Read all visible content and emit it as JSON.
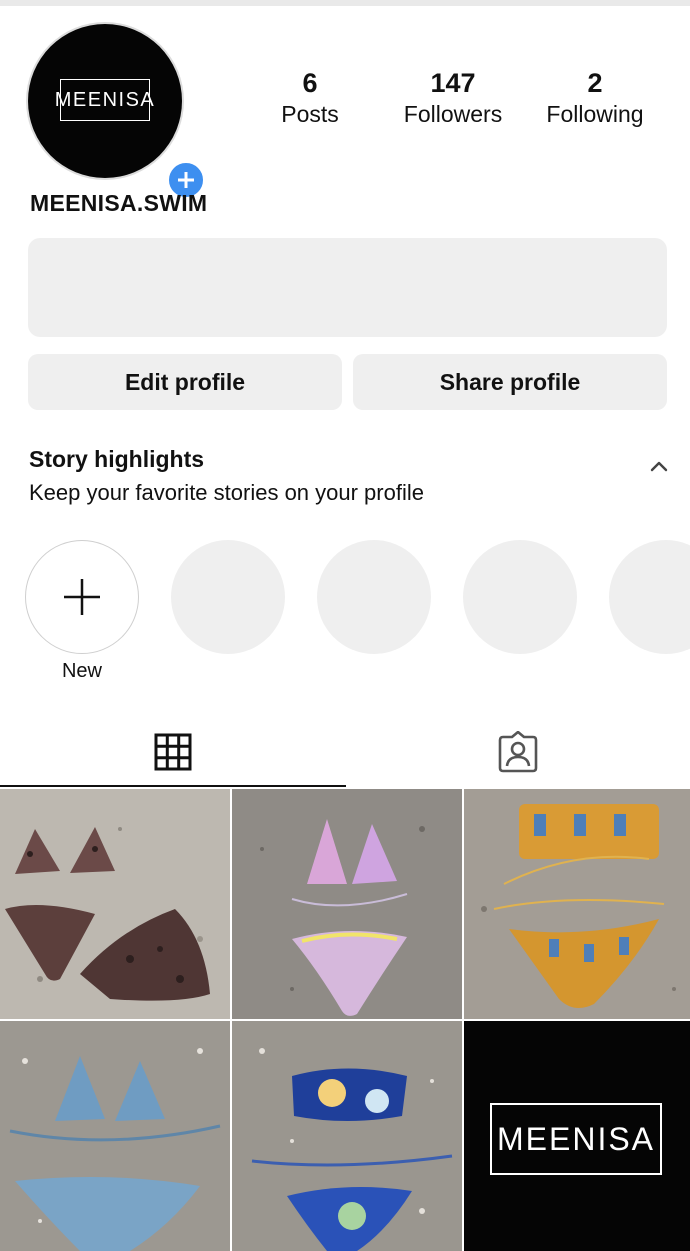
{
  "profile": {
    "avatar_logo_text": "MEENISA",
    "username": "MEENISA.SWIM",
    "stats": {
      "posts_count": "6",
      "posts_label": "Posts",
      "followers_count": "147",
      "followers_label": "Followers",
      "following_count": "2",
      "following_label": "Following"
    }
  },
  "actions": {
    "edit_profile": "Edit profile",
    "share_profile": "Share profile"
  },
  "highlights": {
    "title": "Story highlights",
    "subtitle": "Keep your favorite stories on your profile",
    "new_label": "New"
  },
  "tabs": {
    "posts_icon": "grid-icon",
    "tagged_icon": "tagged-person-icon",
    "active": "posts"
  },
  "posts_grid": {
    "tile6_logo_text": "MEENISA"
  },
  "colors": {
    "accent_blue": "#3d8ff0",
    "panel_gray": "#efefef"
  }
}
